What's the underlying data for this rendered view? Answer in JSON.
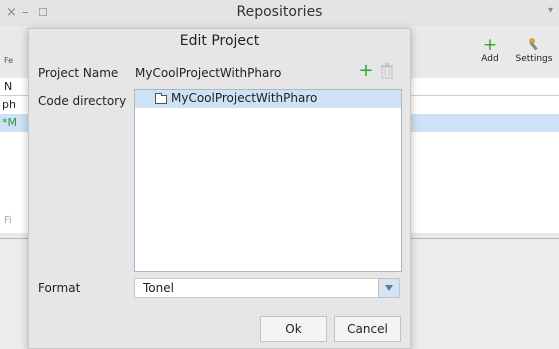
{
  "background_window": {
    "title": "Repositories",
    "close_glyph": "×",
    "minimize_glyph": "–",
    "maximize_glyph": "☐",
    "menu_glyph": "▾",
    "toolbar": [
      {
        "label": "Add",
        "icon": "plus-icon"
      },
      {
        "label": "Settings",
        "icon": "wrench-icon"
      }
    ],
    "fragments": {
      "f_top": "Fe",
      "f_col": "N",
      "f_row1": "ph",
      "f_row2": "*M",
      "f_bottom": "Fi"
    }
  },
  "dialog": {
    "title": "Edit Project",
    "project_name_label": "Project Name",
    "project_name_value": "MyCoolProjectWithPharo",
    "code_directory_label": "Code directory",
    "tree": [
      {
        "label": "MyCoolProjectWithPharo",
        "icon": "folder-icon",
        "selected": true
      }
    ],
    "format_label": "Format",
    "format_value": "Tonel",
    "ok_label": "Ok",
    "cancel_label": "Cancel"
  },
  "colors": {
    "accent_green": "#3aa03a",
    "selection": "#cfe2f5",
    "dropdown_arrow": "#4a80b8"
  }
}
